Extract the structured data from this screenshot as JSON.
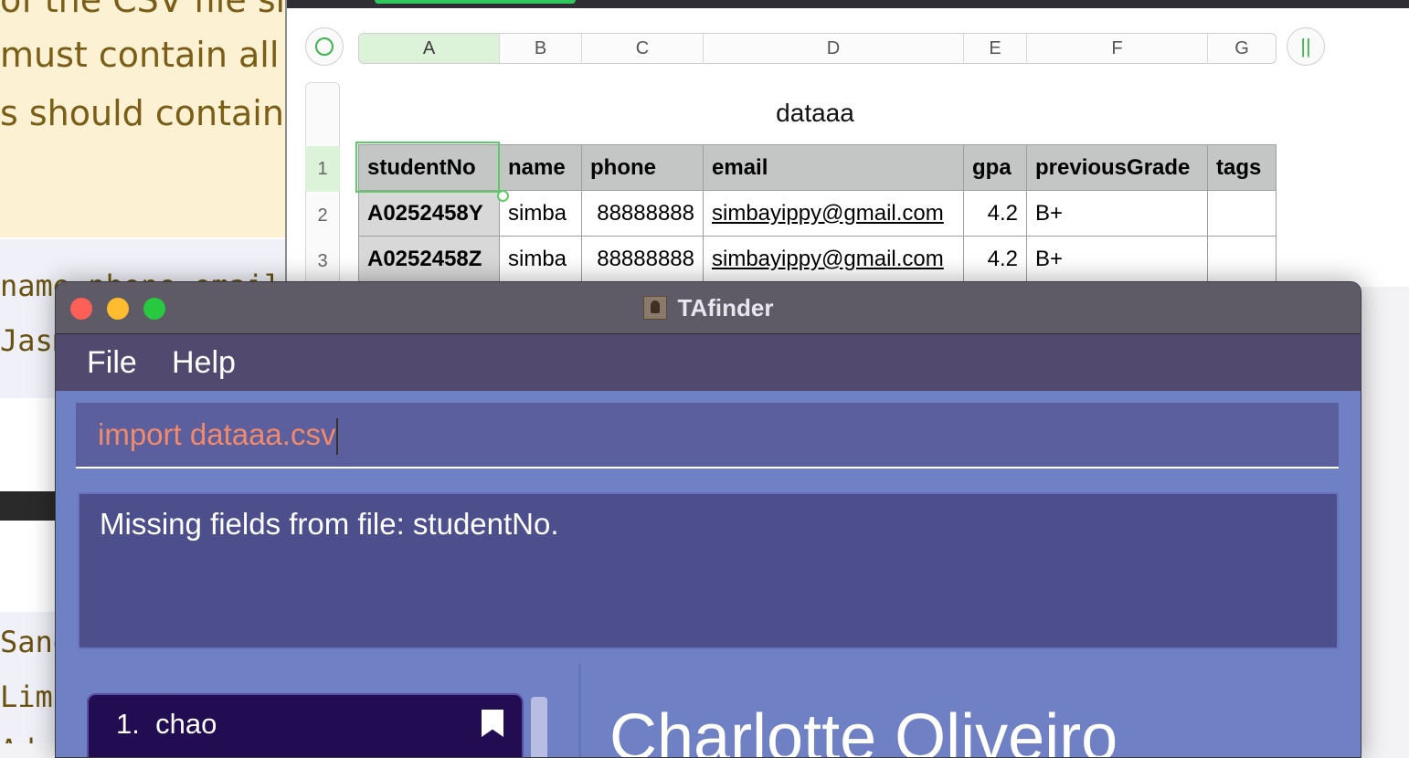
{
  "background_doc": {
    "lines": [
      "of the CSV file sh",
      "must contain all t",
      "s should contain"
    ],
    "code_lines_top": [
      "name,phone,email",
      "Jasm"
    ],
    "code_lines_bottom": [
      "Sand",
      "Lim",
      "Ada"
    ]
  },
  "spreadsheet": {
    "title": "dataaa",
    "columns": [
      "A",
      "B",
      "C",
      "D",
      "E",
      "F",
      "G"
    ],
    "selected_column": "A",
    "row_numbers": [
      "1",
      "2",
      "3"
    ],
    "header": [
      "studentNo",
      "name",
      "phone",
      "email",
      "gpa",
      "previousGrade",
      "tags"
    ],
    "rows": [
      [
        "A0252458Y",
        "simba",
        "88888888",
        "simbayippy@gmail.com",
        "4.2",
        "B+",
        ""
      ],
      [
        "A0252458Z",
        "simba",
        "88888888",
        "simbayippy@gmail.com",
        "4.2",
        "B+",
        ""
      ]
    ],
    "accent_color": "#3bb84a"
  },
  "app": {
    "title": "TAfinder",
    "menu": [
      "File",
      "Help"
    ],
    "command_input": "import dataaa.csv",
    "result_message": "Missing fields from file: studentNo.",
    "list": [
      {
        "index": "1.",
        "name": "chao"
      }
    ],
    "detail_name": "Charlotte Oliveiro",
    "colors": {
      "window_bg": "#6f80c4",
      "menubar": "#514a6e",
      "command_text": "#f08a6a",
      "list_selected": "#220c52"
    }
  }
}
